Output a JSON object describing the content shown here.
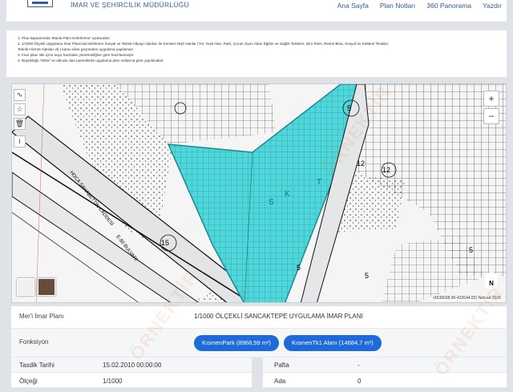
{
  "header": {
    "title": "İMAR VE ŞEHİRCİLİK MÜDÜRLÜĞÜ",
    "nav": [
      "Ana Sayfa",
      "Plan Notları",
      "360 Panorama",
      "Yazdır"
    ]
  },
  "notes": [
    "1. Plan kapsamında 'Mania Planı Kriterlerine' uyulacaktır.",
    "2. 1/1000 Ölçekli Uygulama İmar Planında belirlenen Sosyal ve Teknik Altyapı Alanları ile Kentsel Yeşil Alanlar (Yol, Yeşil Alan, Park, Çocuk Oyun Alanı Eğitim ve Sağlık Tesisleri, Dini Tesis, Resmi Bina, Sosyal Ve Kültürel Tesisler,",
    "Teknik Hizmet Alanları vb.) kamu eline geçmeden uygulama yapılamaz.",
    "3. İmar planı iski içme suyu havzaları yönetmeliğine göre hazırlanmıştır.",
    "4. Büyüklüğü 750m² ve altında olan parsellerde uygulama plan notlarına göre yapılacaktır."
  ],
  "map": {
    "labels": [
      "5",
      "12",
      "12",
      "15",
      "5",
      "5",
      "5",
      "HOCA ŞAHABETTİN CADDESİ",
      "E-80 BULVARI",
      "S",
      "K",
      "T"
    ],
    "coords": "(4538038.96-432644.82) Netcad 2026",
    "zoom_in": "+",
    "zoom_out": "−",
    "north": "N"
  },
  "info": {
    "meri_label": "Mer'i İmar Planı",
    "meri_value": "1/1000 ÖLÇEKLİ SANCAKTEPE UYGULAMA İMAR PLANI",
    "fonksiyon_label": "Fonksiyon",
    "fonksiyon_pills": [
      "KısmenPark (8968,59 m²)",
      "KısmenTk1 Alanı (14684,7 m²)"
    ],
    "tasdik_label": "Tasdik Tarihi",
    "tasdik_value": "15.02.2010 00:00:00",
    "olcek_label": "Ölçeği",
    "olcek_value": "1/1000",
    "pafta_label": "Pafta",
    "pafta_value": "-",
    "ada_label": "Ada",
    "ada_value": "0"
  },
  "watermark": "ÖRNEKTİR",
  "colors": {
    "parcel_fill": "#4fd8dc",
    "road_fill": "#cfd3d7",
    "accent": "#1e6ad8"
  }
}
